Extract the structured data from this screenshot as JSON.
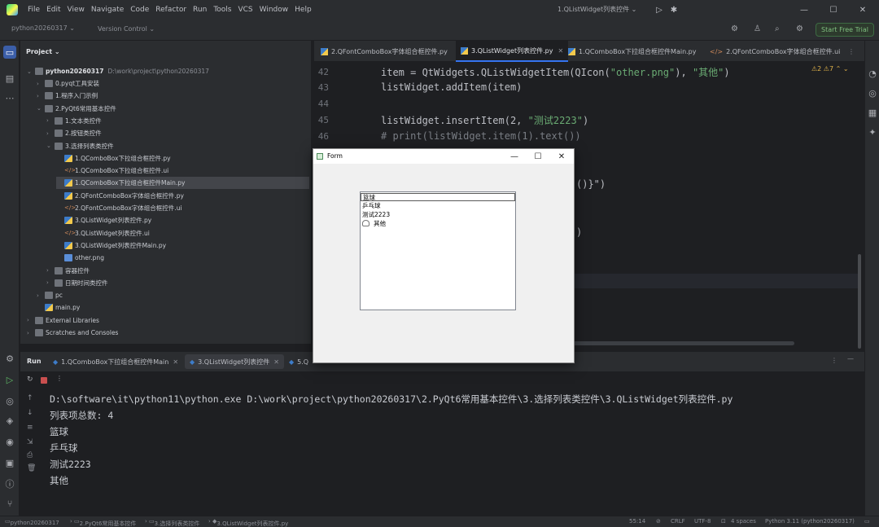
{
  "menubar": {
    "items": [
      "File",
      "Edit",
      "View",
      "Navigate",
      "Code",
      "Refactor",
      "Run",
      "Tools",
      "VCS",
      "Window",
      "Help"
    ],
    "run_config": "1.QListWidget列表控件 ⌄"
  },
  "toolbar": {
    "project": "python20260317 ⌄",
    "vcs": "Version Control ⌄",
    "trial": "Start Free Trial"
  },
  "project_panel": {
    "header": "Project ⌄",
    "root": "python20260317",
    "root_path": "D:\\work\\project\\python20260317",
    "items": [
      {
        "label": "0.pyqt工具安装",
        "kind": "folder",
        "arrow": "›"
      },
      {
        "label": "1.程序入门示例",
        "kind": "folder",
        "arrow": "›"
      },
      {
        "label": "2.PyQt6常用基本控件",
        "kind": "folder",
        "arrow": "⌄"
      },
      {
        "label": "1.文本类控件",
        "kind": "folder",
        "arrow": "›"
      },
      {
        "label": "2.按钮类控件",
        "kind": "folder",
        "arrow": "›"
      },
      {
        "label": "3.选择列表类控件",
        "kind": "folder",
        "arrow": "⌄"
      },
      {
        "label": "1.QComboBox下拉组合框控件.py",
        "kind": "py",
        "arrow": ""
      },
      {
        "label": "1.QComboBox下拉组合框控件.ui",
        "kind": "ui",
        "arrow": ""
      },
      {
        "label": "1.QComboBox下拉组合框控件Main.py",
        "kind": "py",
        "arrow": ""
      },
      {
        "label": "2.QFontComboBox字体组合框控件.py",
        "kind": "py",
        "arrow": ""
      },
      {
        "label": "2.QFontComboBox字体组合框控件.ui",
        "kind": "ui",
        "arrow": ""
      },
      {
        "label": "3.QListWidget列表控件.py",
        "kind": "py",
        "arrow": ""
      },
      {
        "label": "3.QListWidget列表控件.ui",
        "kind": "ui",
        "arrow": ""
      },
      {
        "label": "3.QListWidget列表控件Main.py",
        "kind": "py",
        "arrow": ""
      },
      {
        "label": "other.png",
        "kind": "png",
        "arrow": ""
      },
      {
        "label": "容器控件",
        "kind": "folder",
        "arrow": "›"
      },
      {
        "label": "日期时间类控件",
        "kind": "folder",
        "arrow": "›"
      },
      {
        "label": "pc",
        "kind": "folder",
        "arrow": "›"
      },
      {
        "label": "main.py",
        "kind": "py",
        "arrow": ""
      },
      {
        "label": "External Libraries",
        "kind": "folder",
        "arrow": "›"
      },
      {
        "label": "Scratches and Consoles",
        "kind": "folder",
        "arrow": "›"
      }
    ]
  },
  "editor": {
    "tabs": [
      "2.QFontComboBox字体组合框控件.py",
      "3.QListWidget列表控件.py",
      "1.QComboBox下拉组合框控件Main.py",
      "2.QFontComboBox字体组合框控件.ui"
    ],
    "inspections": "⚠2  ⚠7  ⌃  ⌄",
    "lines": [
      {
        "n": "42",
        "code": "item = QtWidgets.QListWidgetItem(QIcon(",
        "str": "\"other.png\"",
        "mid": "), ",
        "str2": "\"其他\"",
        "tail": ")"
      },
      {
        "n": "43",
        "code": "listWidget.addItem(item)",
        "str": "",
        "mid": "",
        "str2": "",
        "tail": ""
      },
      {
        "n": "44",
        "code": "",
        "str": "",
        "mid": "",
        "str2": "",
        "tail": ""
      },
      {
        "n": "45",
        "code": "listWidget.insertItem(2, ",
        "str": "\"测试2223\"",
        "mid": ")",
        "str2": "",
        "tail": ""
      },
      {
        "n": "46",
        "code": "# print(listWidget.item(1).text())",
        "str": "",
        "mid": "",
        "str2": "",
        "tail": ""
      }
    ],
    "partial_1": "()}\")",
    "partial_2": ")"
  },
  "run_panel": {
    "label": "Run",
    "tabs": [
      "1.QComboBox下拉组合框控件Main",
      "3.QListWidget列表控件",
      "5.Q"
    ],
    "console": [
      "D:\\software\\it\\python11\\python.exe D:\\work\\project\\python20260317\\2.PyQt6常用基本控件\\3.选择列表类控件\\3.QListWidget列表控件.py",
      "列表项总数: 4",
      "篮球",
      "乒乓球",
      "测试2223",
      "其他"
    ]
  },
  "statusbar": {
    "crumbs": [
      "python20260317",
      "2.PyQt6常用基本控件",
      "3.选择列表类控件",
      "3.QListWidget列表控件.py"
    ],
    "position": "55:14",
    "line_sep": "CRLF",
    "encoding": "UTF-8",
    "indent": "4 spaces",
    "interpreter": "Python 3.11 (python20260317)"
  },
  "qt_window": {
    "title": "Form",
    "items": [
      "篮球",
      "乒乓球",
      "测试2223",
      "其他"
    ]
  }
}
